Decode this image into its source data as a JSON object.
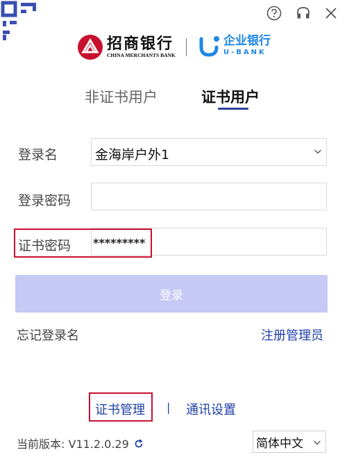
{
  "header": {
    "bank_name_cn": "招商银行",
    "bank_name_en": "CHINA MERCHANTS BANK",
    "ubank_cn": "企业银行",
    "ubank_en": "U-BANK",
    "icons": [
      "qr-code-icon",
      "help-icon",
      "headset-icon",
      "close-icon"
    ]
  },
  "tabs": {
    "non_cert": "非证书用户",
    "cert": "证书用户"
  },
  "form": {
    "username_label": "登录名",
    "username_value": "金海岸户外1",
    "login_password_label": "登录密码",
    "login_password_value": "",
    "cert_password_label": "证书密码",
    "cert_password_value": "*********",
    "login_button": "登录"
  },
  "links": {
    "forgot_username": "忘记登录名",
    "register_admin": "注册管理员",
    "cert_manage": "证书管理",
    "separator": "|",
    "comm_settings": "通讯设置"
  },
  "footer": {
    "version_label": "当前版本:",
    "version_value": "V11.2.0.29",
    "language": "简体中文"
  },
  "colors": {
    "brand_red": "#c8102e",
    "ubank_blue": "#1e88e5",
    "link_blue": "#1f3fa6",
    "login_button_bg": "#c5c9f4"
  }
}
